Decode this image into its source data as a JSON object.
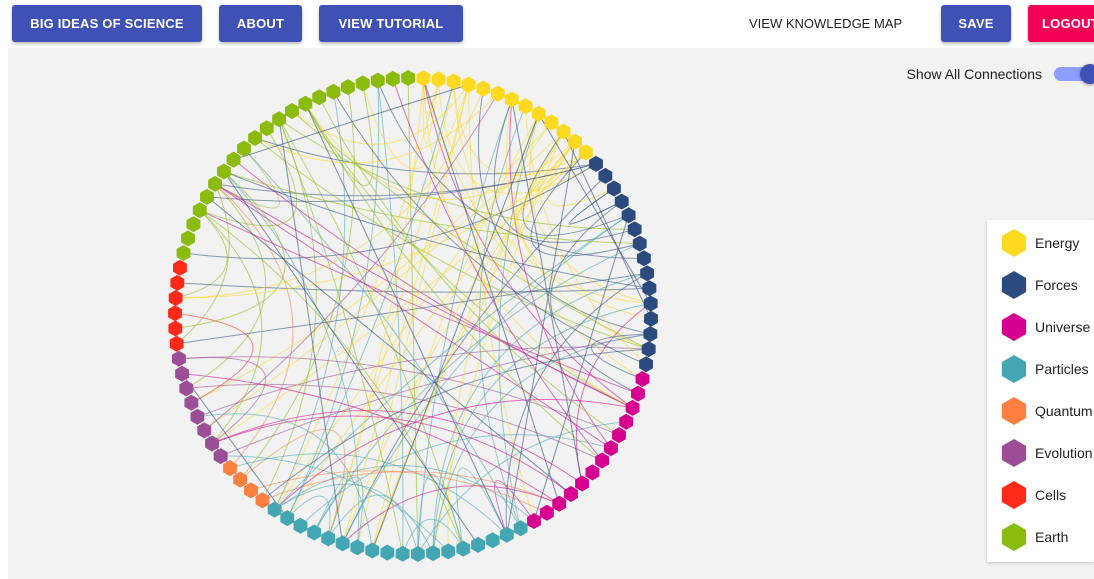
{
  "nav": {
    "big_ideas": "BIG IDEAS OF SCIENCE",
    "about": "ABOUT",
    "tutorial": "VIEW TUTORIAL",
    "knowledge_map": "VIEW KNOWLEDGE MAP",
    "save": "SAVE",
    "logout": "LOGOUT"
  },
  "toggle": {
    "label": "Show All Connections",
    "checked": true
  },
  "legend": {
    "items": [
      {
        "label": "Energy",
        "color": "#fdd91f"
      },
      {
        "label": "Forces",
        "color": "#2b4a7d"
      },
      {
        "label": "Universe",
        "color": "#d5008f"
      },
      {
        "label": "Particles",
        "color": "#44a6b2"
      },
      {
        "label": "Quantum",
        "color": "#ff7f41"
      },
      {
        "label": "Evolution",
        "color": "#9b4d96"
      },
      {
        "label": "Cells",
        "color": "#ff2a1a"
      },
      {
        "label": "Earth",
        "color": "#8bbb0d"
      }
    ]
  },
  "network": {
    "node_counts": {
      "Energy": 13,
      "Forces": 15,
      "Universe": 13,
      "Particles": 18,
      "Quantum": 4,
      "Evolution": 8,
      "Cells": 6,
      "Earth": 21
    }
  }
}
